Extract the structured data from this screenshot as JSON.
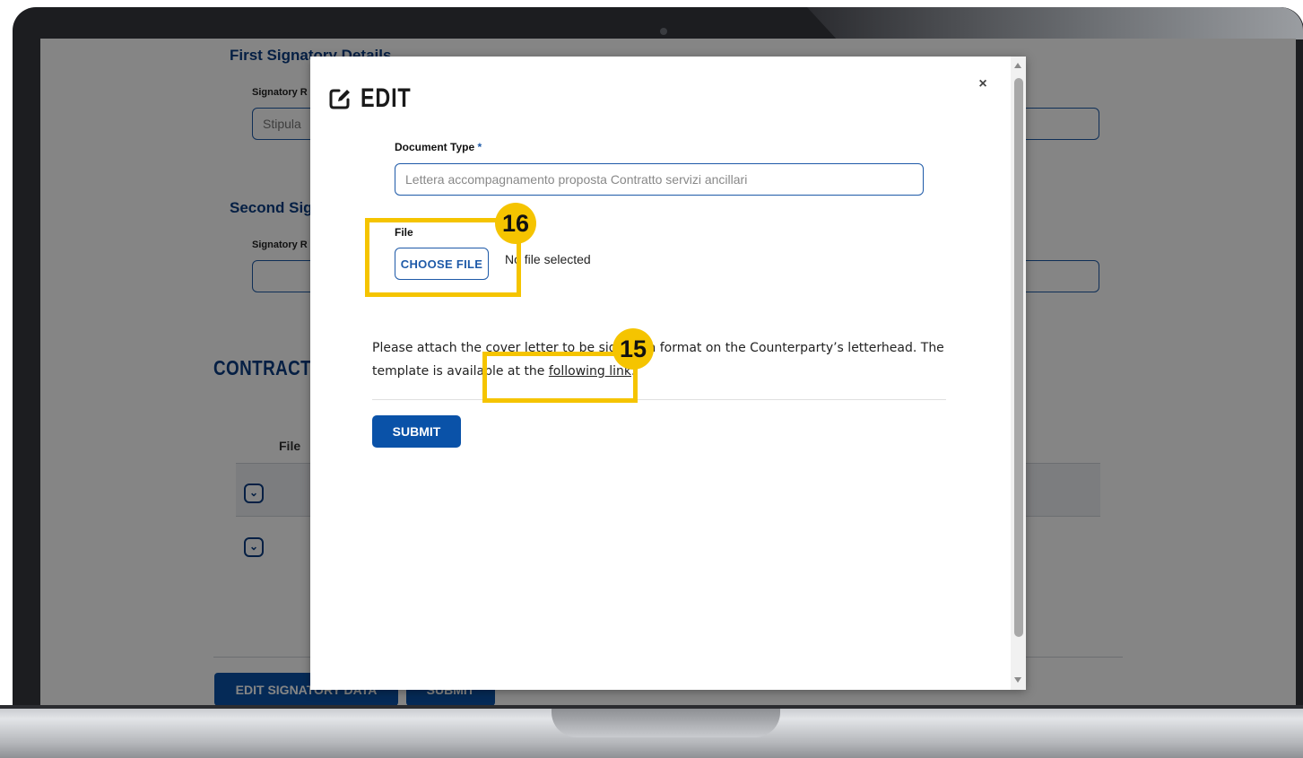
{
  "background": {
    "first_section_title": "First Signatory Details",
    "first_role_label": "Signatory R",
    "first_role_value": "Stipula",
    "second_section_title": "Second Sig",
    "second_role_label": "Signatory R",
    "contract_section_title": "CONTRACT I",
    "table_header_file": "File",
    "edit_signatory_button": "EDIT SIGNATORY DATA",
    "submit_button": "SUBMIT"
  },
  "modal": {
    "title": "EDIT",
    "close_label": "×",
    "document_type_label": "Document Type",
    "required_marker": "*",
    "document_type_value": "Lettera accompagnamento proposta Contratto servizi ancillari",
    "file_label": "File",
    "choose_file_button": "CHOOSE FILE",
    "no_file_text": "No file selected",
    "note_text": "Please attach the cover letter to be signed in format on the Counterparty’s letterhead. The template is available at the ",
    "note_link": "following link",
    "note_end": ".",
    "submit_button": "SUBMIT"
  },
  "annotations": {
    "badge_16": "16",
    "badge_15": "15",
    "highlight_color": "#f5c400"
  },
  "icons": {
    "edit": "edit-icon",
    "close": "close-icon",
    "chevron": "chevron-down-icon"
  },
  "colors": {
    "primary": "#0a52a8",
    "heading": "#0a3d82"
  }
}
